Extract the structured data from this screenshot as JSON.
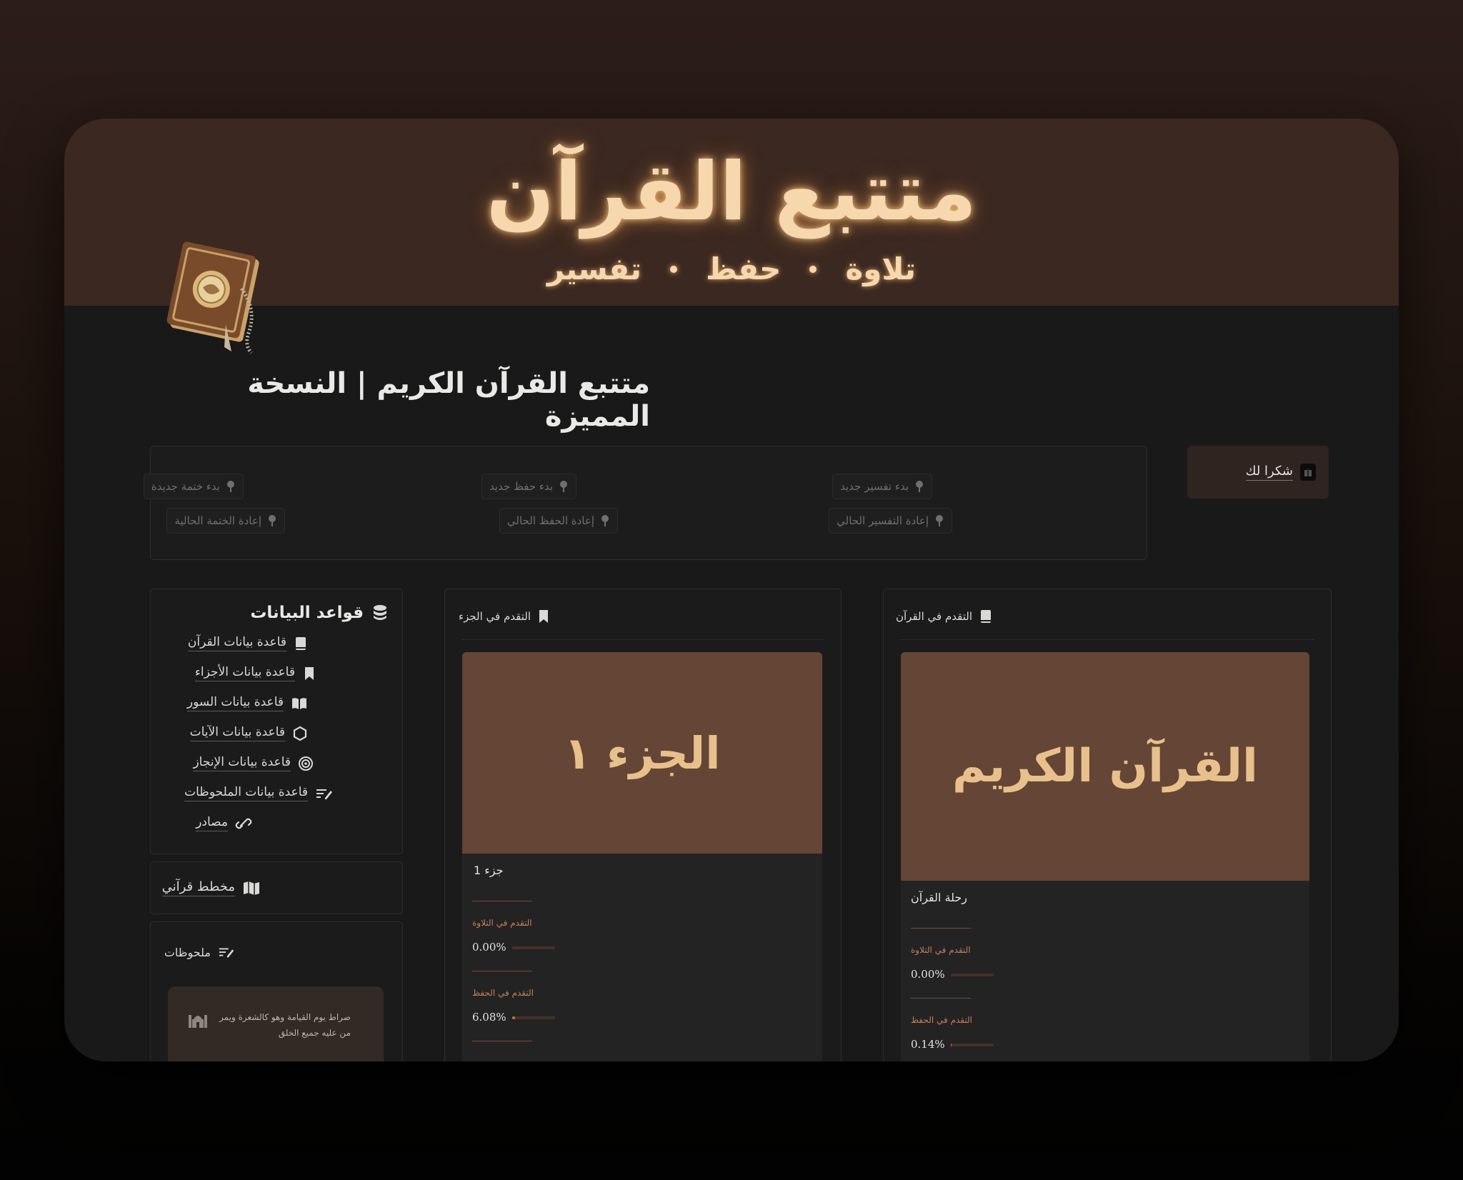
{
  "cover": {
    "title": "متتبع القرآن",
    "subtitle": [
      "تلاوة",
      "حفظ",
      "تفسير"
    ]
  },
  "page_title": "متتبع القرآن الكريم | النسخة المميزة",
  "action_buttons": [
    {
      "label": "بدء ختمة جديدة",
      "icon": "pin-icon"
    },
    {
      "label": "إعادة الختمة الحالية",
      "icon": "pin-icon"
    },
    {
      "label": "بدء حفظ جديد",
      "icon": "pin-icon"
    },
    {
      "label": "إعادة الحفظ الحالي",
      "icon": "pin-icon"
    },
    {
      "label": "بدء تفسير جديد",
      "icon": "pin-icon"
    },
    {
      "label": "إعادة التفسير الحالي",
      "icon": "pin-icon"
    }
  ],
  "thanks": {
    "label": "شكرا لك",
    "icon": "gift-icon"
  },
  "databases": {
    "title": "قواعد البيانات",
    "items": [
      {
        "label": "قاعدة بيانات القرآن",
        "icon": "book-icon"
      },
      {
        "label": "قاعدة بيانات الأجزاء",
        "icon": "bookmark-icon"
      },
      {
        "label": "قاعدة بيانات السور",
        "icon": "open-book-icon"
      },
      {
        "label": "قاعدة بيانات الآيات",
        "icon": "hexagon-icon"
      },
      {
        "label": "قاعدة بيانات الإنجاز",
        "icon": "target-icon"
      },
      {
        "label": "قاعدة بيانات الملحوظات",
        "icon": "notes-icon"
      },
      {
        "label": "مصادر",
        "icon": "link-icon"
      }
    ]
  },
  "planner": {
    "label": "مخطط قرآني",
    "icon": "map-icon"
  },
  "notes": {
    "title": "ملحوظات",
    "card_text": "صراط يوم القيامة وهو كالشعرة ويمر من عليه جميع الخلق"
  },
  "juz_progress": {
    "title": "التقدم في الجزء",
    "cover_text": "الجزء ١",
    "name": "جزء 1",
    "recitation_label": "التقدم في التلاوة",
    "recitation_value": "0.00%",
    "recitation_fraction": 0.0,
    "memorization_label": "التقدم في الحفظ",
    "memorization_value": "6.08%",
    "memorization_fraction": 0.0608
  },
  "quran_progress": {
    "title": "التقدم في القرآن",
    "cover_text": "القرآن الكريم",
    "name": "رحلة القرآن",
    "recitation_label": "التقدم في التلاوة",
    "recitation_value": "0.00%",
    "recitation_fraction": 0.0,
    "memorization_label": "التقدم في الحفظ",
    "memorization_value": "0.14%",
    "memorization_fraction": 0.0014
  },
  "colors": {
    "cover_bg": "#3b2820",
    "title_glow": "#f7d8ae",
    "card_cover": "#654535",
    "progress_accent": "#c96e52"
  }
}
